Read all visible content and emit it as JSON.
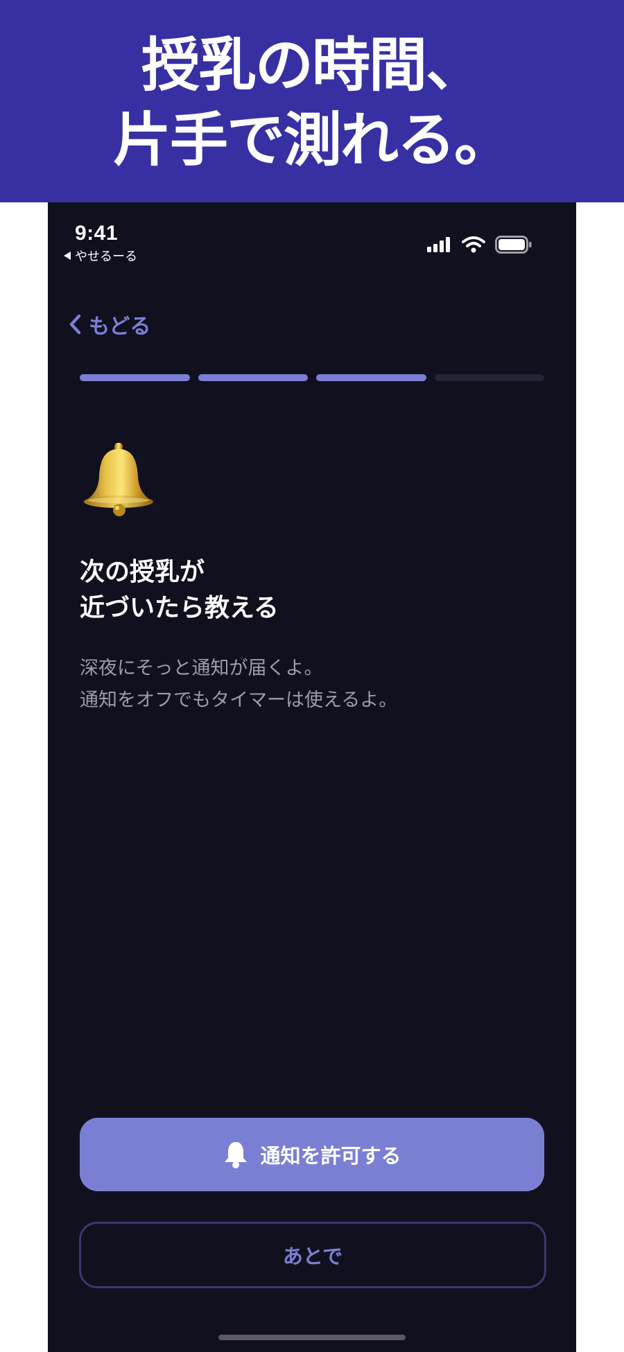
{
  "banner": {
    "headline_line1": "授乳の時間、",
    "headline_line2": "片手で測れる。",
    "background": "#3730a3"
  },
  "status_bar": {
    "time": "9:41",
    "back_app": "やせるーる",
    "icons": [
      "cellular-signal-icon",
      "wifi-icon",
      "battery-icon"
    ]
  },
  "nav": {
    "back_label": "もどる"
  },
  "progress": {
    "total_steps": 4,
    "completed_steps": 3
  },
  "content": {
    "emoji": "bell-icon",
    "title_line1": "次の授乳が",
    "title_line2": "近づいたら教える",
    "desc_line1": "深夜にそっと通知が届くよ。",
    "desc_line2": "通知をオフでもタイマーは使えるよ。"
  },
  "actions": {
    "allow_label": "通知を許可する",
    "later_label": "あとで"
  },
  "colors": {
    "accent": "#7b7fd4",
    "screen_background": "#11101f",
    "secondary_text": "#9d9cab"
  }
}
